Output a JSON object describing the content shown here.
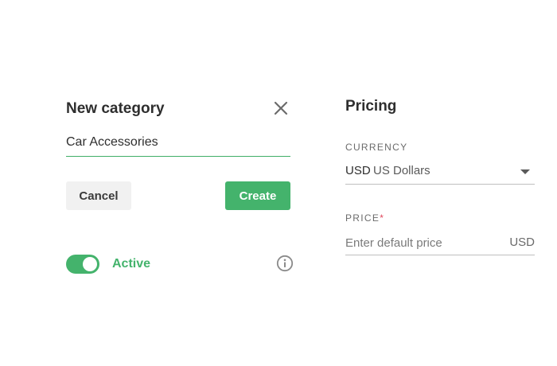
{
  "category": {
    "title": "New category",
    "name_value": "Car Accessories",
    "cancel_label": "Cancel",
    "create_label": "Create",
    "active_label": "Active",
    "active_on": true
  },
  "pricing": {
    "title": "Pricing",
    "currency_label": "CURRENCY",
    "currency_code": "USD",
    "currency_name": "US Dollars",
    "price_label": "PRICE",
    "price_required_mark": "*",
    "price_placeholder": "Enter default price",
    "price_suffix": "USD"
  },
  "colors": {
    "accent": "#44b36c",
    "required": "#e0475c"
  },
  "icons": [
    "close-icon",
    "info-icon",
    "chevron-down-icon"
  ]
}
